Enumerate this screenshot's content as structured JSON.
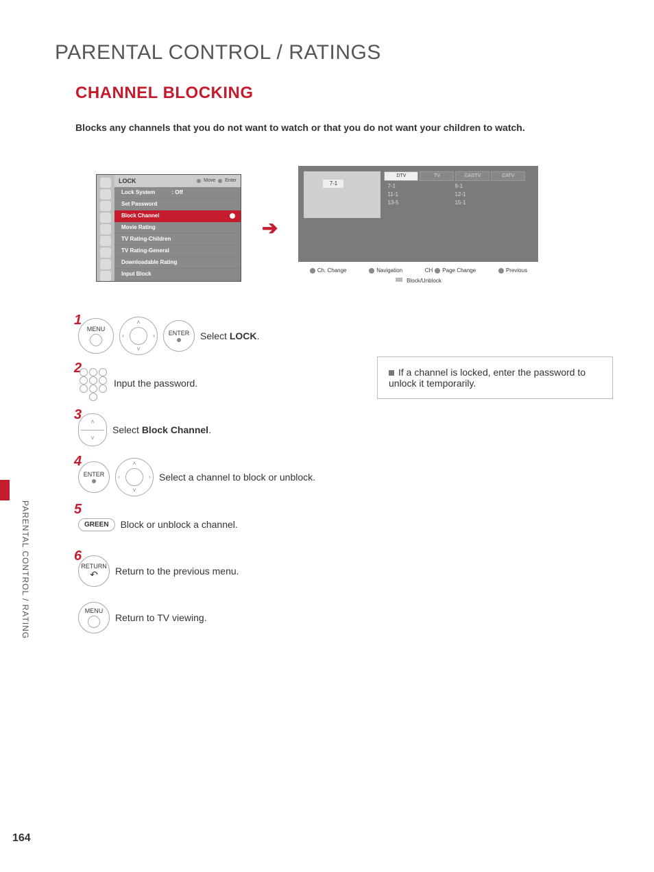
{
  "header": {
    "title": "PARENTAL CONTROL / RATINGS"
  },
  "section": {
    "title": "CHANNEL BLOCKING"
  },
  "intro": "Blocks any channels that you do not want to watch or that you do not want your children to watch.",
  "osd_lock": {
    "title": "LOCK",
    "hint_move": "Move",
    "hint_enter": "Enter",
    "items": [
      {
        "label": "Lock System",
        "value": ": Off"
      },
      {
        "label": "Set Password"
      },
      {
        "label": "Block Channel",
        "selected": true
      },
      {
        "label": "Movie Rating"
      },
      {
        "label": "TV Rating-Children"
      },
      {
        "label": "TV Rating-General"
      },
      {
        "label": "Downloadable Rating"
      },
      {
        "label": "Input Block"
      }
    ]
  },
  "osd_channel": {
    "preview_label": "7-1",
    "tabs": [
      "DTV",
      "TV",
      "CADTV",
      "CATV"
    ],
    "col1": [
      "7-1",
      "11-1",
      "13-5"
    ],
    "col2": [
      "9-1",
      "12-1",
      "15-1"
    ],
    "legend": {
      "ch_change": "Ch. Change",
      "navigation": "Navigation",
      "page_change": "Page Change",
      "page_change_prefix": "CH",
      "previous": "Previous",
      "block": "Block/Unblock"
    }
  },
  "steps": {
    "s1": {
      "num": "1",
      "btn_menu": "MENU",
      "btn_enter": "ENTER",
      "text_pre": "Select ",
      "text_strong": "LOCK",
      "text_post": "."
    },
    "s2": {
      "num": "2",
      "text": "Input the password."
    },
    "s3": {
      "num": "3",
      "text_pre": "Select ",
      "text_strong": "Block Channel",
      "text_post": "."
    },
    "s4": {
      "num": "4",
      "btn_enter": "ENTER",
      "text": "Select a channel to block or unblock."
    },
    "s5": {
      "num": "5",
      "btn_green": "GREEN",
      "text": "Block or unblock a channel."
    },
    "s6": {
      "num": "6",
      "btn_return": "RETURN",
      "text": "Return to the previous menu."
    },
    "s7": {
      "btn_menu": "MENU",
      "text": "Return to TV viewing."
    }
  },
  "note": "If a channel is locked, enter the password to unlock it temporarily.",
  "side_label": "PARENTAL CONTROL / RATING",
  "page_number": "164"
}
